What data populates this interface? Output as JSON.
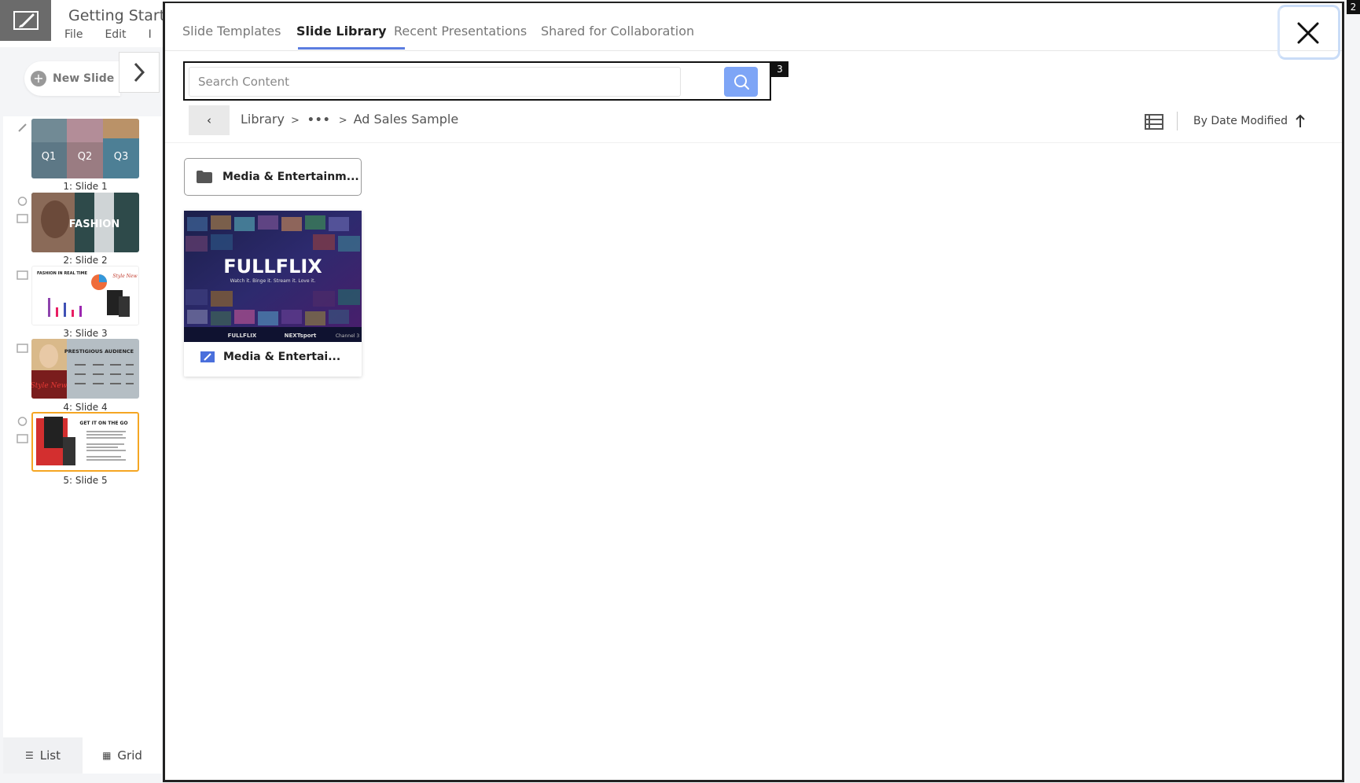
{
  "app": {
    "title": "Getting Start",
    "menu": [
      "File",
      "Edit",
      "I"
    ],
    "new_slide_label": "New Slide",
    "slides": [
      {
        "label": "1: Slide 1",
        "thumb_text": [
          "Q1",
          "Q2",
          "Q3"
        ]
      },
      {
        "label": "2: Slide 2",
        "thumb_text": [
          "FASHION"
        ]
      },
      {
        "label": "3: Slide 3",
        "thumb_text": [
          "FASHION IN REAL TIME",
          "Style New"
        ]
      },
      {
        "label": "4: Slide 4",
        "thumb_text": [
          "PRESTIGIOUS AUDIENCE",
          "Style New"
        ]
      },
      {
        "label": "5: Slide 5",
        "thumb_text": [
          "GET IT ON THE GO"
        ]
      }
    ],
    "selected_slide": 5,
    "view_tabs": {
      "list": "List",
      "grid": "Grid"
    }
  },
  "modal": {
    "tabs": [
      {
        "label": "Slide Templates"
      },
      {
        "label": "Slide Library"
      },
      {
        "label": "Recent Presentations"
      },
      {
        "label": "Shared for Collaboration"
      }
    ],
    "active_tab": "Slide Library",
    "search": {
      "placeholder": "Search Content",
      "value": ""
    },
    "breadcrumb": {
      "root": "Library",
      "ellipsis": "•••",
      "current": "Ad Sales Sample",
      "separator": ">"
    },
    "sort": {
      "label": "By Date Modified",
      "direction": "ascending"
    },
    "folder": {
      "label": "Media & Entertainm..."
    },
    "presentation": {
      "label": "Media & Entertai...",
      "thumb_title": "FULLFLIX",
      "thumb_tagline": "Watch it. Binge it. Stream it. Love it.",
      "thumb_channels": [
        "FULLFLIX",
        "NEXTsport",
        "Channel 3"
      ]
    }
  },
  "overlay_badges": {
    "search": "3",
    "close": "2"
  },
  "colors": {
    "accent": "#5b7de0",
    "search_button": "#7ea5f6",
    "selected_slide_border": "#f5a623"
  }
}
